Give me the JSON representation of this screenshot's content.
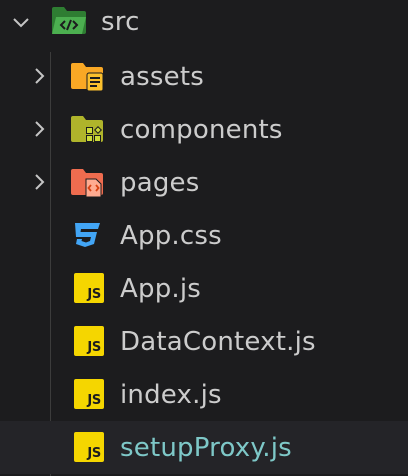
{
  "explorer": {
    "root": {
      "name": "src",
      "expanded": true,
      "icon": "folder-src-open-icon",
      "icon_color": "#4caf50"
    },
    "folders": [
      {
        "name": "assets",
        "expanded": false,
        "icon": "folder-assets-icon",
        "icon_color": "#f9a825"
      },
      {
        "name": "components",
        "expanded": false,
        "icon": "folder-components-icon",
        "icon_color": "#afb42b"
      },
      {
        "name": "pages",
        "expanded": false,
        "icon": "folder-pages-icon",
        "icon_color": "#ef6c4f"
      }
    ],
    "files": [
      {
        "name": "App.css",
        "icon": "css-file-icon",
        "icon_color": "#42a5f5"
      },
      {
        "name": "App.js",
        "icon": "js-file-icon",
        "icon_color": "#f5d600",
        "badge": "JS"
      },
      {
        "name": "DataContext.js",
        "icon": "js-file-icon",
        "icon_color": "#f5d600",
        "badge": "JS"
      },
      {
        "name": "index.js",
        "icon": "js-file-icon",
        "icon_color": "#f5d600",
        "badge": "JS"
      },
      {
        "name": "setupProxy.js",
        "icon": "js-file-icon",
        "icon_color": "#f5d600",
        "badge": "JS",
        "selected": true
      }
    ]
  },
  "colors": {
    "background": "#1c1c1e",
    "text": "#cccccc",
    "selected_text": "#7ec8c8",
    "chevron": "#c5c5c5"
  }
}
